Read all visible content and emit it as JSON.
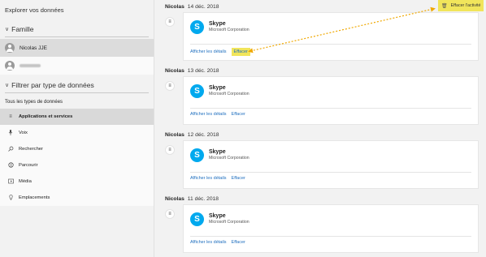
{
  "sidebar": {
    "title": "Explorer vos données",
    "family_heading": "Famille",
    "users": [
      {
        "name": "Nicolas JJE",
        "selected": true
      },
      {
        "name": "",
        "selected": false
      }
    ],
    "filter_heading": "Filtrer par type de données",
    "filter_all": "Tous les types de données",
    "filters": [
      {
        "label": "Applications et services",
        "icon": "apps-list-icon",
        "glyph": "≡",
        "selected": true
      },
      {
        "label": "Voix",
        "icon": "microphone-icon",
        "glyph": "🎙",
        "selected": false
      },
      {
        "label": "Rechercher",
        "icon": "search-icon",
        "glyph": "⚲",
        "selected": false
      },
      {
        "label": "Parcourir",
        "icon": "globe-icon",
        "glyph": "◉",
        "selected": false
      },
      {
        "label": "Média",
        "icon": "media-icon",
        "glyph": "▣",
        "selected": false
      },
      {
        "label": "Emplacements",
        "icon": "location-icon",
        "glyph": "⚐",
        "selected": false
      }
    ]
  },
  "top_action": {
    "label": "Effacer l'activité",
    "icon": "trash-icon"
  },
  "days": [
    {
      "user": "Nicolas",
      "date": "14 déc. 2018",
      "app": "Skype",
      "publisher": "Microsoft Corporation",
      "details_label": "Afficher les détails",
      "clear_label": "Effacer",
      "clear_highlighted": true
    },
    {
      "user": "Nicolas",
      "date": "13 déc. 2018",
      "app": "Skype",
      "publisher": "Microsoft Corporation",
      "details_label": "Afficher les détails",
      "clear_label": "Effacer",
      "clear_highlighted": false
    },
    {
      "user": "Nicolas",
      "date": "12 déc. 2018",
      "app": "Skype",
      "publisher": "Microsoft Corporation",
      "details_label": "Afficher les détails",
      "clear_label": "Effacer",
      "clear_highlighted": false
    },
    {
      "user": "Nicolas",
      "date": "11 déc. 2018",
      "app": "Skype",
      "publisher": "Microsoft Corporation",
      "details_label": "Afficher les détails",
      "clear_label": "Effacer",
      "clear_highlighted": false
    }
  ],
  "colors": {
    "highlight": "#f1e55b",
    "link": "#1f6fbf",
    "skype": "#00a9ee",
    "arrow": "#f0a800"
  }
}
